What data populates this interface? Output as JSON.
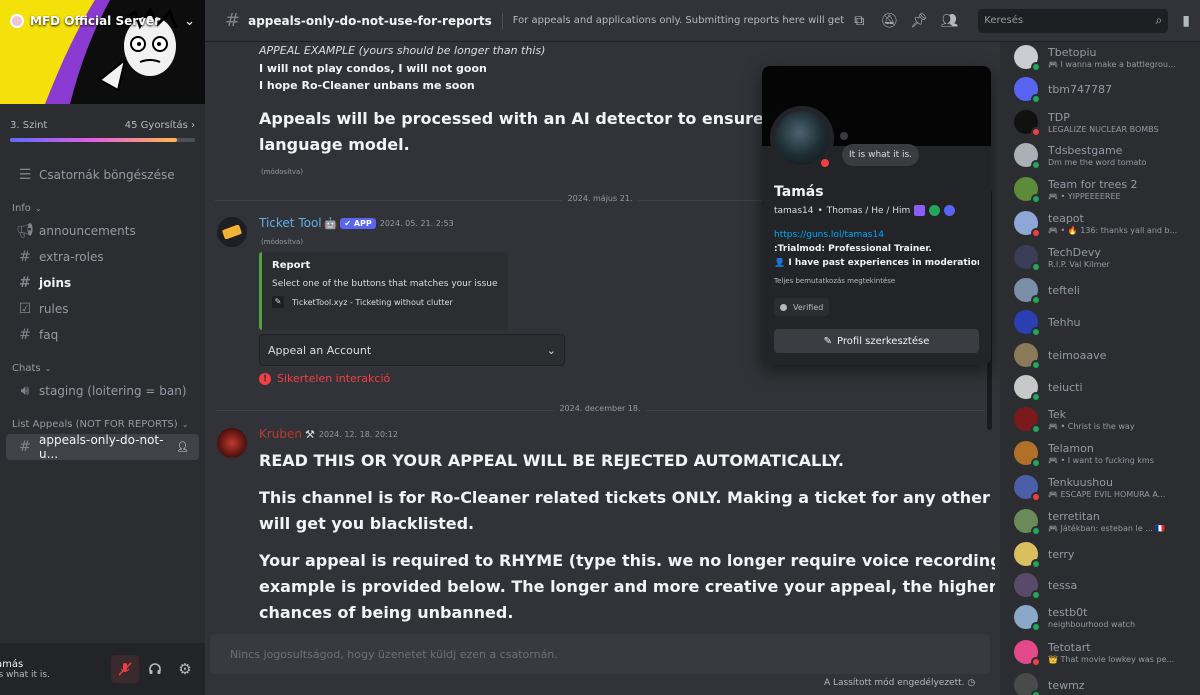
{
  "server": {
    "name": "MFD Official Server",
    "boost_level": "3. Szint",
    "boost_count": "45 Gyorsítás",
    "boost_progress_fraction": 0.9,
    "browse_channels": "Csatornák böngészése"
  },
  "sidebar": {
    "categories": [
      {
        "name": "Info",
        "channels": [
          {
            "name": "announcements",
            "icon": "megaphone-icon",
            "unread": false
          },
          {
            "name": "extra-roles",
            "icon": "hash-icon",
            "unread": false
          },
          {
            "name": "joins",
            "icon": "hash-icon",
            "unread": true
          },
          {
            "name": "rules",
            "icon": "checklist-icon",
            "unread": false
          },
          {
            "name": "faq",
            "icon": "hash-icon",
            "unread": false
          }
        ]
      },
      {
        "name": "Chats",
        "channels": [
          {
            "name": "staging (loitering = ban)",
            "icon": "speaker-icon",
            "unread": false
          }
        ]
      },
      {
        "name": "List Appeals (NOT FOR REPORTS)",
        "channels": [
          {
            "name": "appeals-only-do-not-u...",
            "icon": "hash-icon",
            "unread": false,
            "active": true
          }
        ]
      }
    ]
  },
  "user_panel": {
    "name": "amás",
    "status": "is what it is."
  },
  "header": {
    "channel_name": "appeals-only-do-not-use-for-reports",
    "topic": "For appeals and applications only. Submitting reports here will get you banned.",
    "search_placeholder": "Keresés"
  },
  "messages": {
    "top_italic": "APPEAL EXAMPLE (yours should be longer than this)",
    "top_line1": "I will not play condos, I will not goon",
    "top_line2": "I hope Ro-Cleaner unbans me soon",
    "ai_notice_1": "Appeals will be processed with an AI detector to ensure they're",
    "ai_notice_2": "language model.",
    "edited": "(módosítva)",
    "date_1": "2024. május 21.",
    "ticket_author": "Ticket Tool",
    "ticket_badge": "✔ APP",
    "ticket_time": "2024. 05. 21. 2:53",
    "ticket_edited": "(módosítva)",
    "embed_title": "Report",
    "embed_desc": "Select one of the buttons that matches your issue",
    "embed_footer": "TicketTool.xyz - Ticketing without clutter",
    "select_value": "Appeal an Account",
    "fail_text": "Sikertelen interakció",
    "date_2": "2024. december 18.",
    "kruben_author": "Kruben",
    "kruben_time": "2024. 12. 18. 20:12",
    "k_line1": "READ THIS OR YOUR APPEAL WILL BE REJECTED AUTOMATICALLY.",
    "k_line2a": "This channel is for Ro-Cleaner related tickets ONLY. Making a ticket for any other topic",
    "k_line2b": "will get you blacklisted.",
    "k_line3a": "Your appeal is required to RHYME (type this. we no longer require voice recordings). An",
    "k_line3b": "example is provided below. The longer and more creative your appeal, the higher your",
    "k_line3c": "chances of being unbanned."
  },
  "composer": {
    "placeholder": "Nincs jogosultságod, hogy üzenetet küldj ezen a csatornán.",
    "slowmode": "A Lassított mód engedélyezett."
  },
  "profile": {
    "status_bubble": "It is what it is.",
    "display_name": "Tamás",
    "username": "tamas14",
    "pronouns": "Thomas / He / Him",
    "link": "https://guns.lol/tamas14",
    "bio_line1": ":Trialmod: Professional Trainer.",
    "bio_line2": "👤 I have past experiences in moderation...",
    "full_bio": "Teljes bemutatkozás megtekintése",
    "verified_tag": "Verified",
    "edit_button": "Profil szerkesztése"
  },
  "members": [
    {
      "name": "Tbetopiu",
      "activity": "🎮 I wanna make a battlegrou...",
      "status": "online",
      "color": "#c9ccd1"
    },
    {
      "name": "tbm747787",
      "activity": "",
      "status": "online",
      "color": "#5865f2"
    },
    {
      "name": "TDP",
      "activity": "LEGALIZE NUCLEAR BOMBS",
      "status": "dnd",
      "color": "#111111"
    },
    {
      "name": "Tdsbestgame",
      "activity": "Dm me the word tomato",
      "status": "online",
      "color": "#aab0b8"
    },
    {
      "name": "Team for trees 2",
      "activity": "🎮 • YIPPEEEEREE",
      "status": "online",
      "color": "#5c8c3a"
    },
    {
      "name": "teapot",
      "activity": "🎮 • 🔥 136: thanks yall and b...",
      "status": "dnd",
      "color": "#8fa7d8"
    },
    {
      "name": "TechDevy",
      "activity": "R.I.P. Val Kilmer",
      "status": "online",
      "color": "#3a3d55"
    },
    {
      "name": "tefteli",
      "activity": "",
      "status": "online",
      "color": "#7a8fa8"
    },
    {
      "name": "Tehhu",
      "activity": "",
      "status": "online",
      "color": "#2a3fb0"
    },
    {
      "name": "teimoaave",
      "activity": "",
      "status": "online",
      "color": "#8a7a5a"
    },
    {
      "name": "teiucti",
      "activity": "",
      "status": "online",
      "color": "#c8c8c8"
    },
    {
      "name": "Tek",
      "activity": "🎮 • Christ is the way",
      "status": "online",
      "color": "#7a1a1a"
    },
    {
      "name": "Telamon",
      "activity": "🎮 • I want to fucking kms",
      "status": "online",
      "color": "#b0702a"
    },
    {
      "name": "Tenkuushou",
      "activity": "🎮 ESCAPE EVIL HOMURA A...",
      "status": "dnd",
      "color": "#4a5fa8"
    },
    {
      "name": "terretitan",
      "activity": "🎮 Játékban: esteban le ... 🇫🇷",
      "status": "online",
      "color": "#6a8a5a"
    },
    {
      "name": "terry",
      "activity": "",
      "status": "online",
      "color": "#d8c060"
    },
    {
      "name": "tessa",
      "activity": "",
      "status": "online",
      "color": "#5a4a6a"
    },
    {
      "name": "testb0t",
      "activity": "neighbourhood watch",
      "status": "online",
      "color": "#8aa8c8"
    },
    {
      "name": "Tetotart",
      "activity": "👑 That movie lowkey was pe...",
      "status": "dnd",
      "color": "#e24a8a"
    },
    {
      "name": "tewmz",
      "activity": "",
      "status": "online",
      "color": "#4a4a4a"
    }
  ],
  "colors": {
    "accent": "#5865f2",
    "online": "#23a55a",
    "dnd": "#f23f42",
    "link": "#00a8fc",
    "kruben": "#c0392b"
  }
}
